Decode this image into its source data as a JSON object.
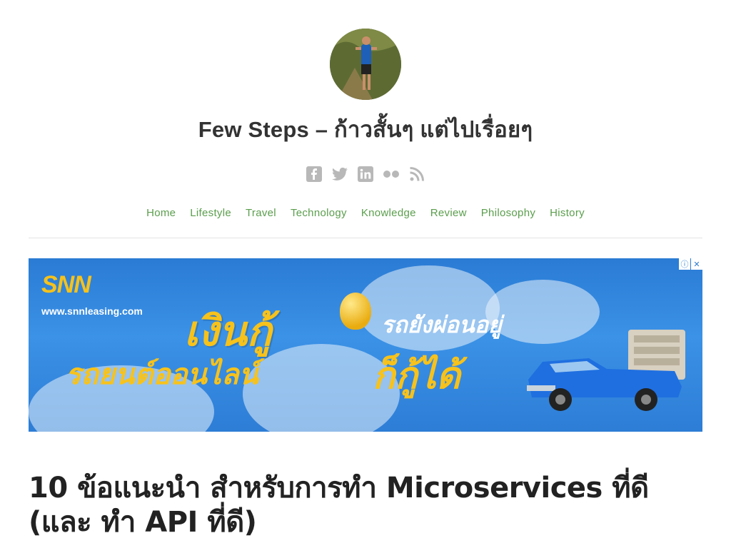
{
  "site": {
    "title": "Few Steps – ก้าวสั้นๆ แต่ไปเรื่อยๆ"
  },
  "social": [
    {
      "icon": "facebook-icon"
    },
    {
      "icon": "twitter-icon"
    },
    {
      "icon": "linkedin-icon"
    },
    {
      "icon": "flickr-icon"
    },
    {
      "icon": "rss-icon"
    }
  ],
  "nav": {
    "items": [
      "Home",
      "Lifestyle",
      "Travel",
      "Technology",
      "Knowledge",
      "Review",
      "Philosophy",
      "History"
    ]
  },
  "ad": {
    "logo": "SNN",
    "url": "www.snnleasing.com",
    "headline1": "เงินกู้",
    "headline2": "รถยนต์ออนไลน์",
    "headline3": "รถยังผ่อนอยู่",
    "headline4": "ก็กู้ได้",
    "info_icon": "ⓘ",
    "close_icon": "✕"
  },
  "post": {
    "title": "10 ข้อแนะนำ สำหรับการทำ Microservices ที่ดี (และ ทำ API ที่ดี)"
  },
  "colors": {
    "nav_link": "#5a9e4c",
    "social_icon": "#b8b8b8",
    "ad_background": "#2a7bd4",
    "ad_accent": "#f7c21b"
  }
}
